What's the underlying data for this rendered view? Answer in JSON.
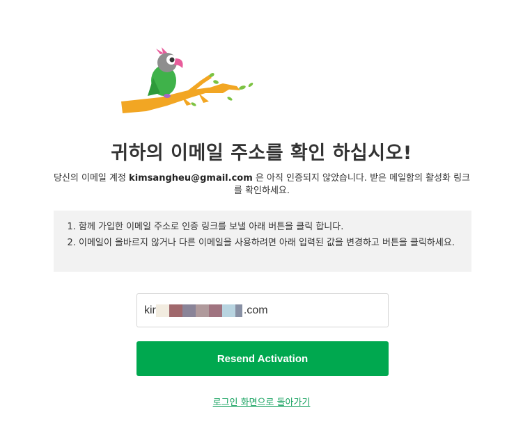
{
  "logo": {
    "icon": "parrot-on-branch-icon",
    "colors": {
      "parrot_body": "#3fb24a",
      "parrot_head": "#8e8e8e",
      "beak": "#e85c9b",
      "branch": "#f2a623",
      "leaves": "#7cc242"
    }
  },
  "page": {
    "title": "귀하의 이메일 주소를 확인 하십시오!",
    "intro_before": "당신의 이메일 계정 ",
    "intro_email": "kimsangheu@gmail.com",
    "intro_after": " 은 아직 인증되지 않았습니다. 받은 메일함의 활성화 링크를 확인하세요."
  },
  "steps": [
    "함께 가입한 이메일 주소로 인증 링크를 보낼 아래 버튼을 클릭 합니다.",
    "이메일이 올바르지 않거나 다른 이메일을 사용하려면 아래 입력된 값을 변경하고 버튼을 클릭하세요."
  ],
  "form": {
    "email_prefix": "kir",
    "email_suffix": ".com",
    "redaction_colors": [
      "#f2ece0",
      "#a0686c",
      "#8a8498",
      "#b09a9c",
      "#a07480",
      "#b8d4e0",
      "#8890a4"
    ],
    "resend_label": "Resend Activation"
  },
  "footer": {
    "back_link": "로그인 화면으로 돌아가기"
  },
  "colors": {
    "accent": "#00a84f",
    "link": "#12a05c",
    "panel_bg": "#f2f2f2"
  }
}
